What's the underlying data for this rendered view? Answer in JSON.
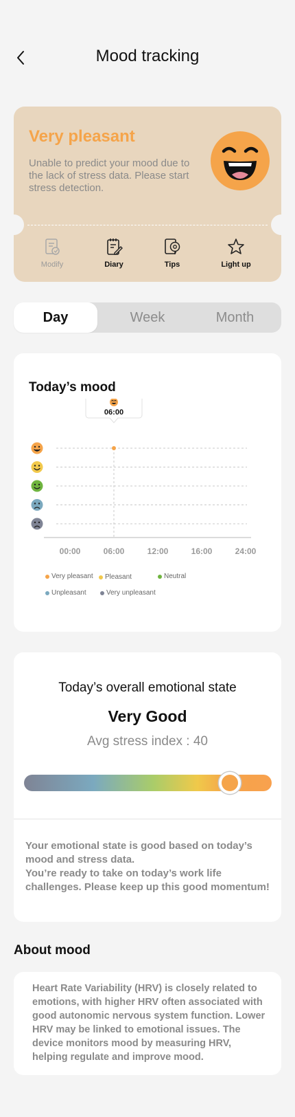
{
  "header": {
    "title": "Mood tracking",
    "back_icon": "chevron-left-icon"
  },
  "mood_card": {
    "mood": "Very pleasant",
    "description": "Unable to predict your mood due to the lack of stress data. Please start stress detection.",
    "accent_color": "#f5a44a",
    "background_color": "#e8d6be",
    "actions": [
      {
        "label": "Modify",
        "icon": "edit-document-icon",
        "enabled": false
      },
      {
        "label": "Diary",
        "icon": "diary-icon",
        "enabled": true
      },
      {
        "label": "Tips",
        "icon": "tips-icon",
        "enabled": true
      },
      {
        "label": "Light up",
        "icon": "star-icon",
        "enabled": true
      }
    ]
  },
  "tabs": {
    "items": [
      "Day",
      "Week",
      "Month"
    ],
    "active": "Day"
  },
  "todays_mood": {
    "title": "Today’s mood",
    "chart_data": {
      "type": "scatter",
      "x_ticks": [
        "00:00",
        "06:00",
        "12:00",
        "16:00",
        "24:00"
      ],
      "y_categories": [
        "Very pleasant",
        "Pleasant",
        "Neutral",
        "Unpleasant",
        "Very unpleasant"
      ],
      "points": [
        {
          "x": "06:00",
          "y": "Very pleasant"
        }
      ],
      "tooltip": {
        "time": "06:00",
        "mood": "Very pleasant"
      },
      "grid": true,
      "legend": [
        {
          "name": "Very pleasant",
          "color": "#f5a44a"
        },
        {
          "name": "Pleasant",
          "color": "#f2c94c"
        },
        {
          "name": "Neutral",
          "color": "#6fb43f"
        },
        {
          "name": "Unpleasant",
          "color": "#7ba9bf"
        },
        {
          "name": "Very unpleasant",
          "color": "#7f8495"
        }
      ],
      "legend_placement": "bottom"
    }
  },
  "emotional_state": {
    "title": "Today’s overall emotional state",
    "value": "Very Good",
    "stress_label": "Avg stress index : 40",
    "slider_level": 0.83,
    "message_line1": "Your emotional state is good based on today’s mood and stress data.",
    "message_line2": "You’re ready to take on today’s work life challenges. Please keep up this good momentum!"
  },
  "about": {
    "title": "About mood",
    "text": "Heart Rate Variability (HRV) is closely related to emotions, with higher HRV often associated with good autonomic nervous system function. Lower HRV may be linked to emotional issues. The device monitors mood by measuring HRV, helping regulate and improve mood."
  }
}
